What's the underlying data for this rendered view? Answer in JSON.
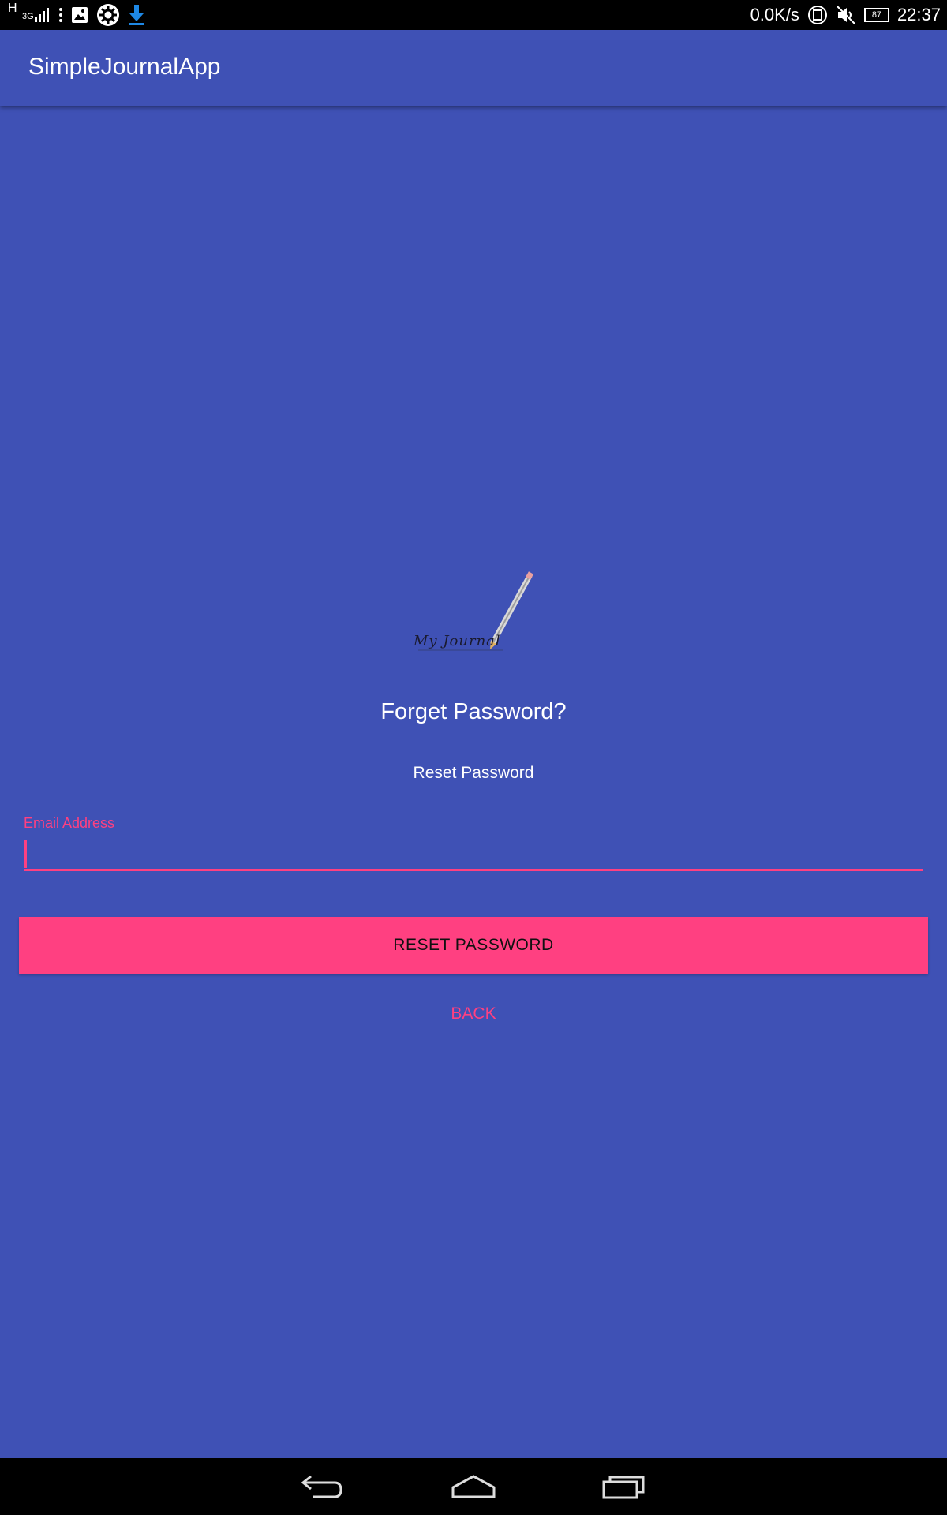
{
  "status_bar": {
    "network_type": "H",
    "signal_label": "3G",
    "net_speed": "0.0K/s",
    "battery_level": "87",
    "time": "22:37",
    "icons": [
      "signal-icon",
      "more-vert-icon",
      "image-icon",
      "gear-icon",
      "download-icon",
      "rotation-icon",
      "mute-icon",
      "battery-icon"
    ]
  },
  "app_bar": {
    "title": "SimpleJournalApp"
  },
  "logo": {
    "script_text": "My Journal"
  },
  "main": {
    "heading": "Forget Password?",
    "subheading": "Reset Password",
    "email_label": "Email Address",
    "email_value": "",
    "reset_button_label": "RESET PASSWORD",
    "back_button_label": "BACK"
  },
  "nav_bar": {
    "icons": [
      "back-icon",
      "home-icon",
      "recents-icon"
    ]
  },
  "colors": {
    "primary": "#3F51B5",
    "accent": "#FF4081"
  }
}
